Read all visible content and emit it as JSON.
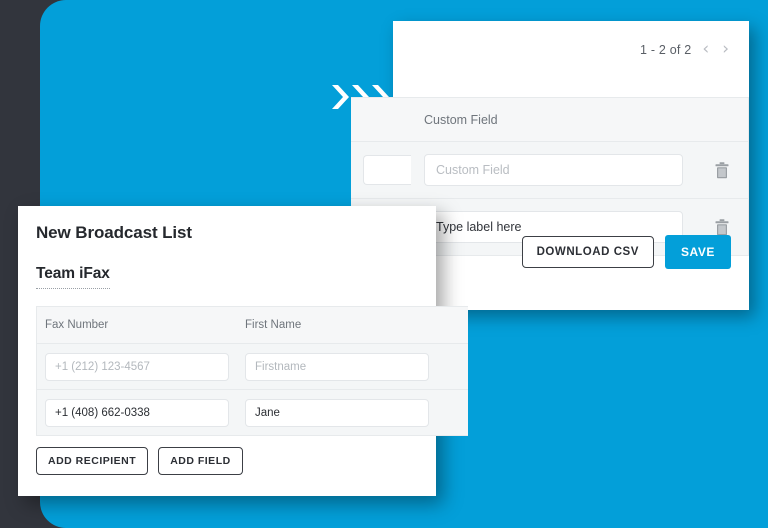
{
  "theme": {
    "brand_blue": "#039fd9",
    "dark_background": "#32353d",
    "card_background": "#ffffff",
    "table_background": "#f4f6f7",
    "border": "#e7eaec",
    "placeholder_text": "#b3b8bd",
    "value_text": "#2b2e33"
  },
  "decoration": {
    "chevrons_icon": "triple-chevron-right-icon"
  },
  "back_panel": {
    "pagination": {
      "label": "1 - 2 of 2",
      "prev_icon": "chevron-left-icon",
      "next_icon": "chevron-right-icon",
      "prev_glyph": "‹",
      "next_glyph": "›"
    },
    "table": {
      "column_header": "Custom Field",
      "rows": [
        {
          "value": "Custom Field",
          "is_placeholder": true,
          "delete_icon": "trash-icon"
        },
        {
          "value": "Type label here",
          "is_placeholder": false,
          "delete_icon": "trash-icon"
        }
      ]
    },
    "actions": {
      "download_csv_label": "DOWNLOAD CSV",
      "save_label": "SAVE"
    }
  },
  "front_panel": {
    "title": "New Broadcast List",
    "list_name": "Team iFax",
    "table": {
      "columns": [
        "Fax Number",
        "First Name"
      ],
      "rows": [
        {
          "fax_number": "+1 (212) 123-4567",
          "first_name": "Firstname",
          "is_placeholder": true
        },
        {
          "fax_number": "+1 (408) 662-0338",
          "first_name": "Jane",
          "is_placeholder": false
        }
      ]
    },
    "buttons": {
      "add_recipient_label": "ADD RECIPIENT",
      "add_field_label": "ADD FIELD"
    }
  }
}
